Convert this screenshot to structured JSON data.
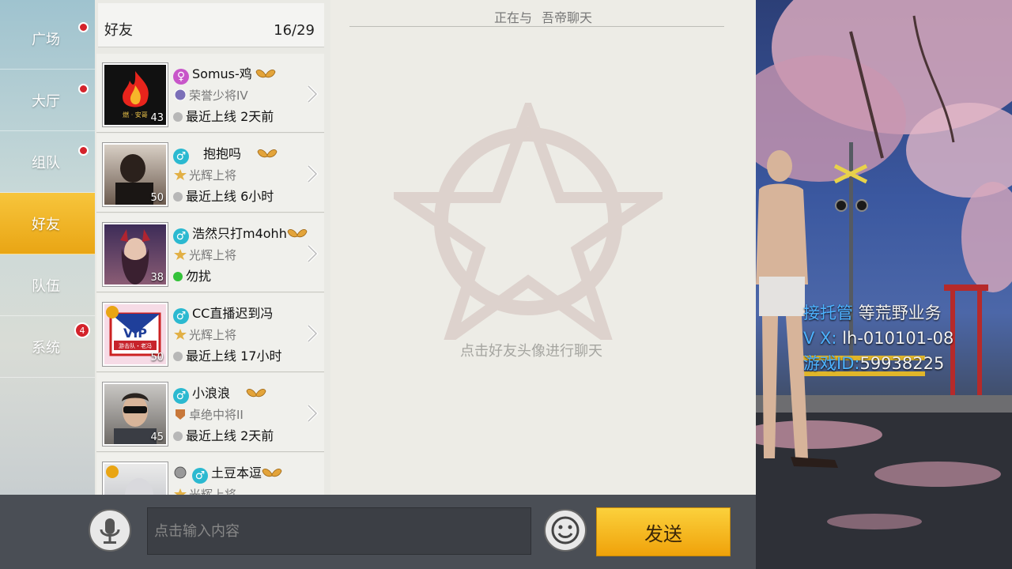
{
  "nav": {
    "items": [
      {
        "label": "广场",
        "dot": true
      },
      {
        "label": "大厅",
        "dot": true
      },
      {
        "label": "组队",
        "dot": true
      },
      {
        "label": "好友",
        "active": true
      },
      {
        "label": "队伍"
      },
      {
        "label": "系统",
        "badge": "4"
      }
    ]
  },
  "friends_header": {
    "title": "好友",
    "count": "16/29"
  },
  "friends": [
    {
      "name": "Somus-鸡",
      "gender": "female",
      "rank": "荣誉少将IV",
      "status": "最近上线 2天前",
      "online": false,
      "level": "43",
      "avatar_text": "燃 · 安哥"
    },
    {
      "name": "抱抱吗",
      "gender": "male",
      "rank": "光辉上将",
      "status": "最近上线 6小时",
      "online": false,
      "level": "50"
    },
    {
      "name": "浩然只打m4ohh",
      "gender": "male",
      "rank": "光辉上将",
      "status": "勿扰",
      "online": true,
      "level": "38"
    },
    {
      "name": "CC直播迟到冯",
      "gender": "male",
      "rank": "光辉上将",
      "status": "最近上线 17小时",
      "online": false,
      "level": "50",
      "avatar_text": "VIP",
      "avatar_sub": "游击队・老冯"
    },
    {
      "name": "小浪浪",
      "gender": "male",
      "rank": "卓绝中将II",
      "status": "最近上线 2天前",
      "online": false,
      "level": "45"
    },
    {
      "name": "土豆本逗",
      "gender": "male",
      "rank": "光辉上将",
      "status": "",
      "online": false,
      "level": ""
    }
  ],
  "chat": {
    "title_prefix": "正在与",
    "partner": "吾帝聊天",
    "hint": "点击好友头像进行聊天"
  },
  "input": {
    "placeholder": "点击输入内容",
    "value": ""
  },
  "send_label": "发送",
  "overlay": {
    "line1_key": "接托管",
    "line1_val": "等荒野业务",
    "line2_key": "V   X:",
    "line2_val": "lh-010101-08",
    "line3_key": "游戏ID:",
    "line3_val": "59938225"
  },
  "colors": {
    "accent_gold": "#f0a20a",
    "badge_red": "#d4232b",
    "gender_blue": "#2bb9d0",
    "overlay_blue": "#4db2ff"
  }
}
